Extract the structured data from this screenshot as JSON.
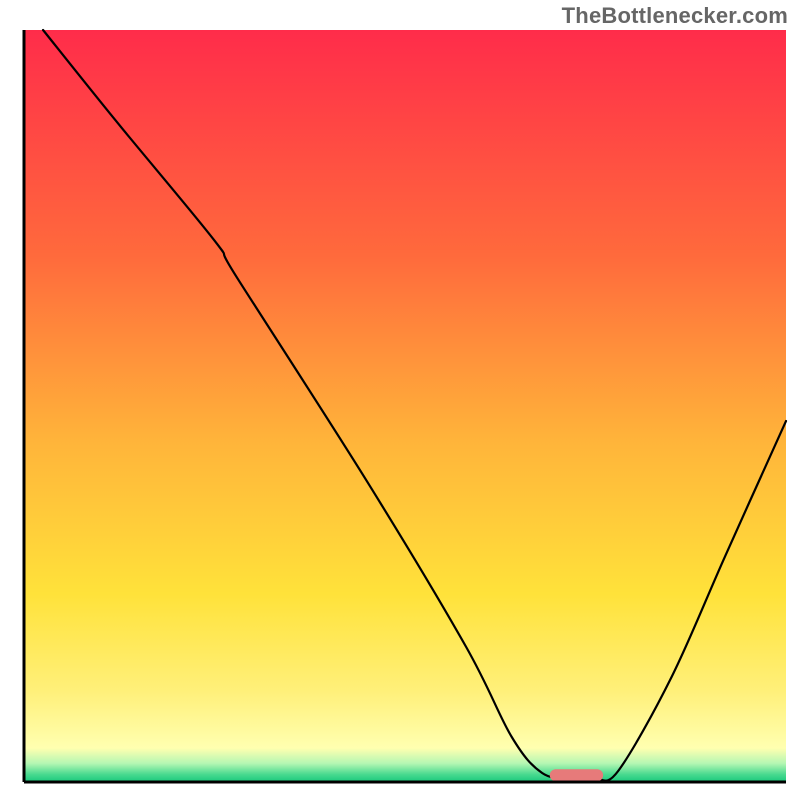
{
  "watermark": "TheBottlenecker.com",
  "chart_data": {
    "type": "line",
    "title": "",
    "xlabel": "",
    "ylabel": "",
    "xlim": [
      0,
      100
    ],
    "ylim": [
      0,
      100
    ],
    "background": {
      "type": "vertical-gradient",
      "stops": [
        {
          "offset": 0.0,
          "color": "#ff2c4a"
        },
        {
          "offset": 0.3,
          "color": "#ff6a3c"
        },
        {
          "offset": 0.55,
          "color": "#ffb53a"
        },
        {
          "offset": 0.75,
          "color": "#ffe23a"
        },
        {
          "offset": 0.88,
          "color": "#fff07a"
        },
        {
          "offset": 0.955,
          "color": "#ffffb0"
        },
        {
          "offset": 0.975,
          "color": "#b6f7b3"
        },
        {
          "offset": 0.99,
          "color": "#48d98f"
        },
        {
          "offset": 1.0,
          "color": "#19c97c"
        }
      ]
    },
    "curve": {
      "description": "Bottleneck curve (lower is better). Starts at top-left (100), descends steeply, flattens to ~0 around x≈68–75, then rises toward the right edge.",
      "points": [
        {
          "x": 2.5,
          "y": 100
        },
        {
          "x": 12,
          "y": 88
        },
        {
          "x": 25,
          "y": 72
        },
        {
          "x": 28,
          "y": 67
        },
        {
          "x": 45,
          "y": 40
        },
        {
          "x": 58,
          "y": 18
        },
        {
          "x": 64,
          "y": 6
        },
        {
          "x": 68,
          "y": 1.2
        },
        {
          "x": 72,
          "y": 0.4
        },
        {
          "x": 75,
          "y": 0.4
        },
        {
          "x": 78,
          "y": 1.5
        },
        {
          "x": 85,
          "y": 14
        },
        {
          "x": 92,
          "y": 30
        },
        {
          "x": 100,
          "y": 48
        }
      ]
    },
    "marker": {
      "x_center": 72.5,
      "x_halfwidth": 3.5,
      "y": 0.9,
      "color": "#e77a7a"
    },
    "axes": {
      "color": "#000000",
      "width": 3
    },
    "curve_style": {
      "color": "#000000",
      "width": 2.2
    }
  }
}
